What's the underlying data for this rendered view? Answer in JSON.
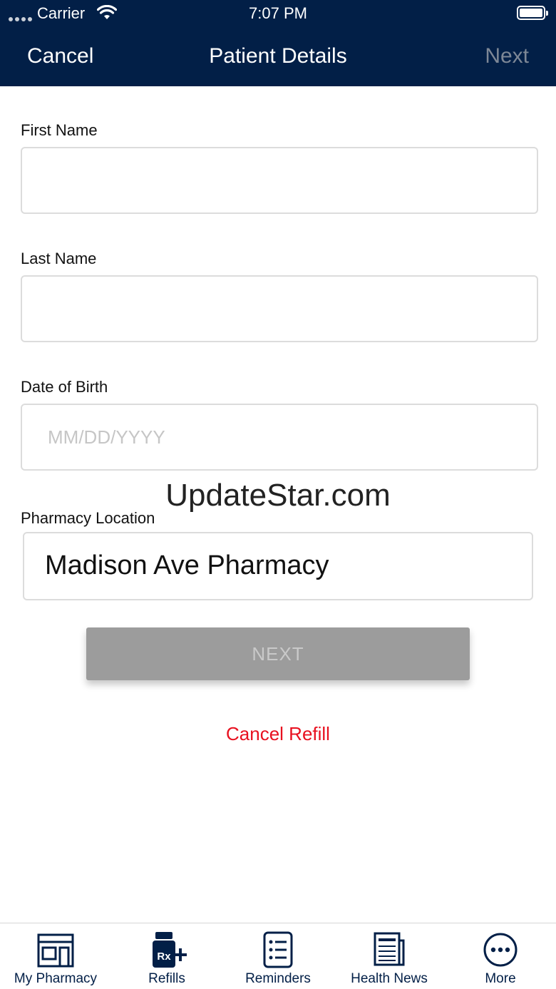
{
  "status_bar": {
    "carrier": "Carrier",
    "time": "7:07 PM"
  },
  "nav": {
    "cancel": "Cancel",
    "title": "Patient Details",
    "next": "Next"
  },
  "form": {
    "first_name": {
      "label": "First Name",
      "value": ""
    },
    "last_name": {
      "label": "Last Name",
      "value": ""
    },
    "dob": {
      "label": "Date of Birth",
      "placeholder": "MM/DD/YYYY",
      "value": ""
    },
    "pharmacy": {
      "label": "Pharmacy Location",
      "value": "Madison Ave Pharmacy"
    }
  },
  "watermark": "UpdateStar.com",
  "buttons": {
    "next": "NEXT",
    "cancel_refill": "Cancel Refill"
  },
  "tabs": [
    {
      "label": "My Pharmacy",
      "icon": "storefront-icon"
    },
    {
      "label": "Refills",
      "icon": "rx-bottle-icon"
    },
    {
      "label": "Reminders",
      "icon": "checklist-icon"
    },
    {
      "label": "Health News",
      "icon": "newspaper-icon"
    },
    {
      "label": "More",
      "icon": "more-icon"
    }
  ],
  "colors": {
    "header": "#021f47",
    "accent_red": "#e8101f",
    "disabled_button": "#9c9c9c",
    "tab_icon": "#021f47"
  }
}
